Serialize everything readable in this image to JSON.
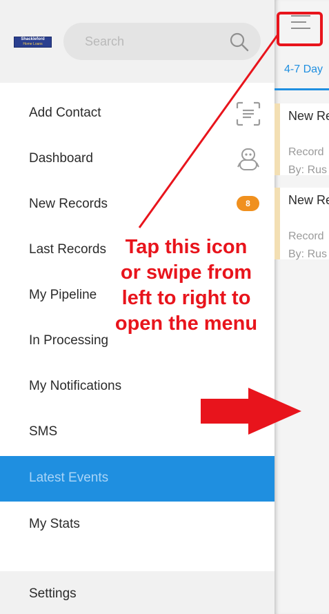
{
  "header": {
    "logo_title": "Shackleford",
    "logo_subtitle": "Home Loans",
    "search_placeholder": "Search"
  },
  "menu": {
    "items": [
      {
        "label": "Add Contact",
        "icon": "scan-icon"
      },
      {
        "label": "Dashboard",
        "icon": "robot-icon"
      },
      {
        "label": "New Records",
        "badge": "8"
      },
      {
        "label": "Last Records"
      },
      {
        "label": "My Pipeline"
      },
      {
        "label": "In Processing"
      },
      {
        "label": "My Notifications"
      },
      {
        "label": "SMS"
      },
      {
        "label": "Latest Events",
        "active": true
      },
      {
        "label": "My Stats"
      }
    ],
    "settings_label": "Settings"
  },
  "right_panel": {
    "tab_label": "4-7 Day",
    "cards": [
      {
        "title": "New Re",
        "subtitle": "Record",
        "by": "By: Rus"
      },
      {
        "title": "New Re",
        "subtitle": "Record",
        "by": "By: Rus"
      }
    ]
  },
  "annotation": {
    "lines": [
      "Tap this icon",
      "or swipe from",
      "left to right to",
      "open the menu"
    ]
  },
  "colors": {
    "accent_blue": "#1f8fe0",
    "annotation_red": "#e8141c",
    "badge_orange": "#f0901e"
  }
}
